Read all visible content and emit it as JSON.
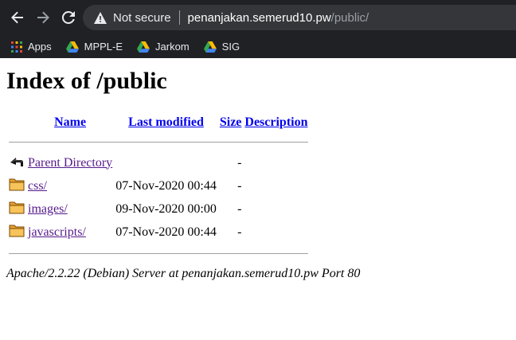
{
  "browser": {
    "security_label": "Not secure",
    "url_host": "penanjakan.semerud10.pw",
    "url_path": "/public/",
    "bookmarks": [
      {
        "label": "Apps",
        "icon": "apps-grid-icon"
      },
      {
        "label": "MPPL-E",
        "icon": "google-drive-icon"
      },
      {
        "label": "Jarkom",
        "icon": "google-drive-icon"
      },
      {
        "label": "SIG",
        "icon": "google-drive-icon"
      }
    ]
  },
  "page": {
    "title": "Index of /public",
    "columns": {
      "name": "Name",
      "last_modified": "Last modified",
      "size": "Size",
      "description": "Description"
    },
    "rows": [
      {
        "name": "Parent Directory",
        "modified": "",
        "size": "-",
        "icon": "back-arrow-icon"
      },
      {
        "name": "css/",
        "modified": "07-Nov-2020 00:44",
        "size": "-",
        "icon": "folder-icon"
      },
      {
        "name": "images/",
        "modified": "09-Nov-2020 00:00",
        "size": "-",
        "icon": "folder-icon"
      },
      {
        "name": "javascripts/",
        "modified": "07-Nov-2020 00:44",
        "size": "-",
        "icon": "folder-icon"
      }
    ],
    "footer": "Apache/2.2.22 (Debian) Server at penanjakan.semerud10.pw Port 80"
  }
}
